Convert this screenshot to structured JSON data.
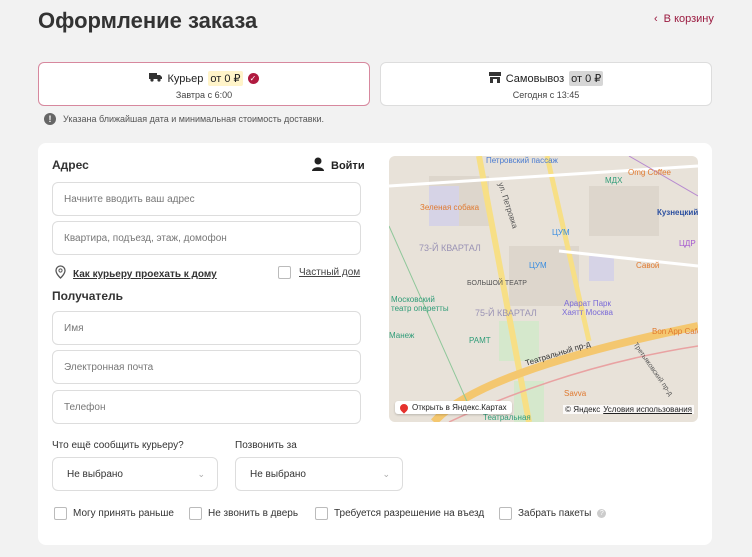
{
  "header": {
    "title": "Оформление заказа",
    "back_label": "В корзину"
  },
  "delivery_tabs": [
    {
      "label": "Курьер",
      "price": "от 0 ₽",
      "subtitle": "Завтра с 6:00",
      "selected": true,
      "icon": "truck-icon"
    },
    {
      "label": "Самовывоз",
      "price": "от 0 ₽",
      "subtitle": "Сегодня с 13:45",
      "selected": false,
      "icon": "store-icon"
    }
  ],
  "note": "Указана ближайшая дата и минимальная стоимость доставки.",
  "address": {
    "heading": "Адрес",
    "login_label": "Войти",
    "address_placeholder": "Начните вводить ваш адрес",
    "details_placeholder": "Квартира, подъезд, этаж, домофон",
    "directions_link": "Как курьеру проехать к дому",
    "private_house_label": "Частный дом"
  },
  "recipient": {
    "heading": "Получатель",
    "name_placeholder": "Имя",
    "email_placeholder": "Электронная почта",
    "phone_placeholder": "Телефон"
  },
  "extras": {
    "courier_message_label": "Что ещё сообщить курьеру?",
    "courier_message_value": "Не выбрано",
    "call_before_label": "Позвонить за",
    "call_before_value": "Не выбрано"
  },
  "options": [
    "Могу принять раньше",
    "Не звонить в дверь",
    "Требуется разрешение на въезд",
    "Забрать пакеты"
  ],
  "map": {
    "open_label": "Открыть в Яндекс.Картах",
    "copyright": "© Яндекс",
    "terms_link": "Условия использования",
    "labels": [
      "Петровский пассаж",
      "ул. Петровка",
      "Зеленая собака",
      "МДХ",
      "Omg Coffee",
      "Кузнецкий",
      "ЦУМ",
      "ЦУМ",
      "73-Й КВАРТАЛ",
      "БОЛЬШОЙ ТЕАТР",
      "Московский театр оперетты",
      "75-Й КВАРТАЛ",
      "Арарат Парк Хаятт Москва",
      "Савой",
      "ЦДР",
      "РАМТ",
      "Театральный пр-д",
      "Bon App Cafe",
      "Savva",
      "Третьяковский пр-д",
      "Манеж",
      "Театральная"
    ]
  },
  "colors": {
    "accent": "#b0193f",
    "price_highlight": "#fff4c9",
    "pickup_price_bg": "#d6d6d6"
  }
}
